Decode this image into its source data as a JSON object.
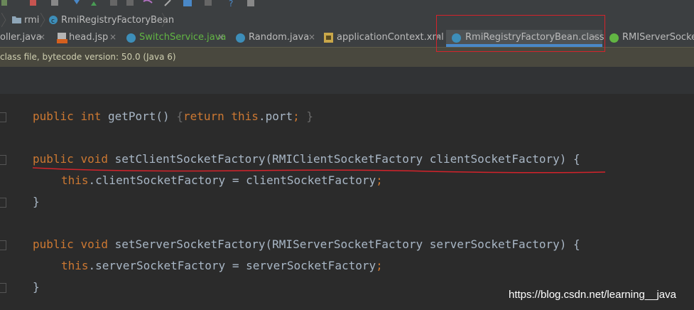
{
  "breadcrumb": {
    "items": [
      "rmi",
      "RmiRegistryFactoryBean"
    ]
  },
  "tabs": [
    {
      "label": "oller.java",
      "icon": "java-class-icon",
      "active": false
    },
    {
      "label": "head.jsp",
      "icon": "jsp-file-icon",
      "active": false
    },
    {
      "label": "SwitchService.java",
      "icon": "java-class-icon",
      "active": false
    },
    {
      "label": "Random.java",
      "icon": "java-class-icon",
      "active": false
    },
    {
      "label": "applicationContext.xml",
      "icon": "xml-file-icon",
      "active": false
    },
    {
      "label": "RmiRegistryFactoryBean.class",
      "icon": "class-file-icon",
      "active": true
    },
    {
      "label": "RMIServerSocket",
      "icon": "interface-icon",
      "active": false
    }
  ],
  "tab_close_glyph": "×",
  "info_bar": {
    "text": "class file, bytecode version: 50.0 (Java 6)"
  },
  "code": {
    "getPort": {
      "modifier": "public",
      "type": "int",
      "name": "getPort",
      "parens": "()",
      "open": "{",
      "ret": "return",
      "this": "this",
      "dot_field": ".port",
      "semi": ";",
      "close": "}"
    },
    "setClient": {
      "modifier": "public",
      "type": "void",
      "name": "setClientSocketFactory",
      "params": "(RMIClientSocketFactory clientSocketFactory)",
      "open": "{",
      "this": "this",
      "field": ".clientSocketFactory",
      "assign": " = clientSocketFactory",
      "semi": ";",
      "close": "}"
    },
    "setServer": {
      "modifier": "public",
      "type": "void",
      "name": "setServerSocketFactory",
      "params": "(RMIServerSocketFactory serverSocketFactory)",
      "open": "{",
      "this": "this",
      "field": ".serverSocketFactory",
      "assign": " = serverSocketFactory",
      "semi": ";",
      "close": "}"
    }
  },
  "watermark": "https://blog.csdn.net/learning__java",
  "colors": {
    "keyword": "#cc7832",
    "field": "#9876aa",
    "text": "#a9b7c6",
    "highlight": "#d4232b",
    "tab_active_underline": "#4a88c7"
  }
}
